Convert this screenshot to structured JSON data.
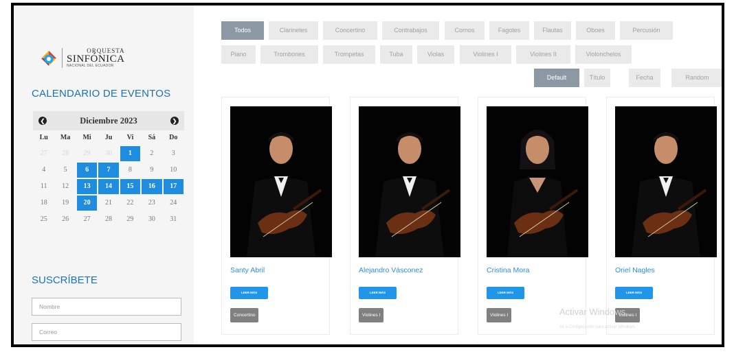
{
  "logo": {
    "top": "ORQUESTA",
    "main": "SINFÓNICA",
    "sub": "NACIONAL DEL ECUADOR",
    "colors": [
      "#e23a3a",
      "#f2b01e",
      "#2aa6dd",
      "#7c3d9b"
    ]
  },
  "calendar": {
    "title": "CALENDARIO DE EVENTOS",
    "month": "Diciembre 2023",
    "prev_icon": "chevron-left-icon",
    "next_icon": "chevron-right-icon",
    "weekdays": [
      "Lu",
      "Ma",
      "Mi",
      "Ju",
      "Vi",
      "Sá",
      "Do"
    ],
    "days": [
      {
        "d": "27",
        "s": "muted"
      },
      {
        "d": "28",
        "s": "muted"
      },
      {
        "d": "29",
        "s": "muted"
      },
      {
        "d": "30",
        "s": "muted"
      },
      {
        "d": "1",
        "s": "event"
      },
      {
        "d": "2",
        "s": ""
      },
      {
        "d": "3",
        "s": ""
      },
      {
        "d": "4",
        "s": ""
      },
      {
        "d": "5",
        "s": ""
      },
      {
        "d": "6",
        "s": "event"
      },
      {
        "d": "7",
        "s": "event"
      },
      {
        "d": "8",
        "s": ""
      },
      {
        "d": "9",
        "s": ""
      },
      {
        "d": "10",
        "s": ""
      },
      {
        "d": "11",
        "s": ""
      },
      {
        "d": "12",
        "s": ""
      },
      {
        "d": "13",
        "s": "event"
      },
      {
        "d": "14",
        "s": "event"
      },
      {
        "d": "15",
        "s": "event"
      },
      {
        "d": "16",
        "s": "event"
      },
      {
        "d": "17",
        "s": "event"
      },
      {
        "d": "18",
        "s": ""
      },
      {
        "d": "19",
        "s": ""
      },
      {
        "d": "20",
        "s": "event"
      },
      {
        "d": "21",
        "s": ""
      },
      {
        "d": "22",
        "s": ""
      },
      {
        "d": "23",
        "s": ""
      },
      {
        "d": "24",
        "s": ""
      },
      {
        "d": "25",
        "s": ""
      },
      {
        "d": "26",
        "s": ""
      },
      {
        "d": "27",
        "s": ""
      },
      {
        "d": "28",
        "s": ""
      },
      {
        "d": "29",
        "s": ""
      },
      {
        "d": "30",
        "s": ""
      },
      {
        "d": "31",
        "s": ""
      }
    ],
    "event_color": "#1e8de0"
  },
  "subscribe": {
    "title": "SUSCRÍBETE",
    "name_placeholder": "Nombre",
    "email_placeholder": "Correo"
  },
  "filters": {
    "row1": [
      "Todos",
      "Clarinetes",
      "Concertino",
      "Contrabajos",
      "Cornos",
      "Fagotes",
      "Flautas",
      "Oboes",
      "Percusión"
    ],
    "row2": [
      "Piano",
      "Trombones",
      "Trompetas",
      "Tuba",
      "Violas",
      "Violines I",
      "Violines II",
      "Violonchelos"
    ],
    "active": "Todos"
  },
  "sort": {
    "options": [
      "Default",
      "Título",
      "Fecha",
      "Random"
    ],
    "active": "Default"
  },
  "musicians": [
    {
      "name": "Santy Abril",
      "button": "LEER MÁS",
      "section": "Concertino",
      "instrument": "violin"
    },
    {
      "name": "Alejandro Vásconez",
      "button": "LEER MÁS",
      "section": "Violines I",
      "instrument": "violin"
    },
    {
      "name": "Cristina Mora",
      "button": "LEER MÁS",
      "section": "Violines I",
      "instrument": "violin"
    },
    {
      "name": "Oriel Nagles",
      "button": "LEER MÁS",
      "section": "Violines I",
      "instrument": "violin"
    }
  ],
  "watermark": {
    "title": "Activar Windows",
    "subtitle": "Ve a Configuración para activar Windows."
  }
}
